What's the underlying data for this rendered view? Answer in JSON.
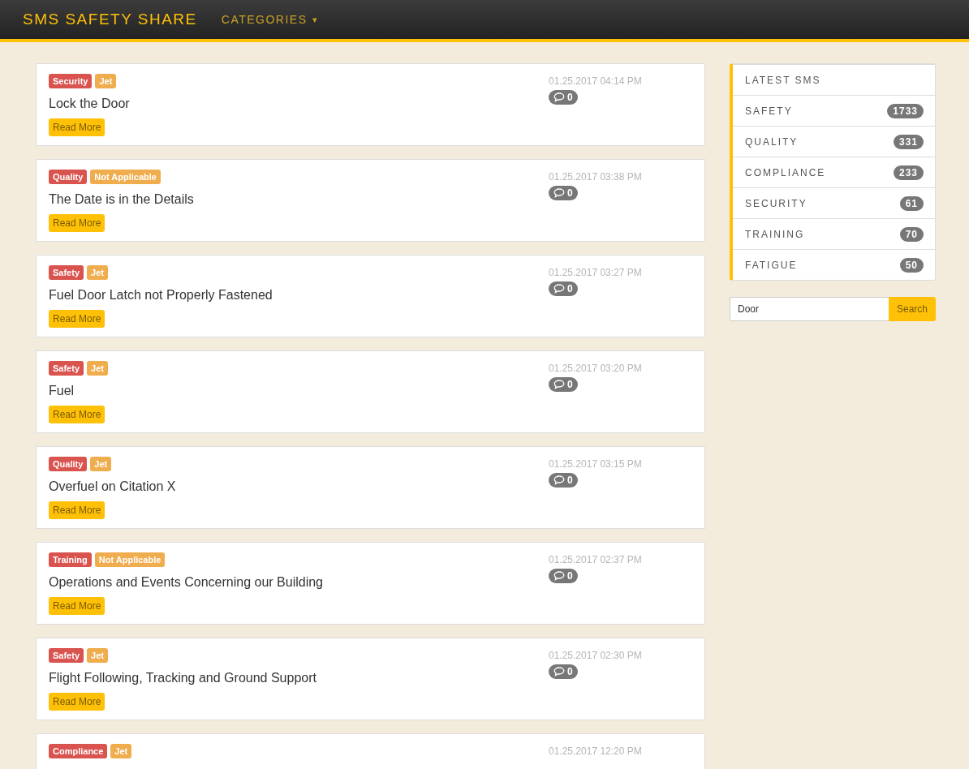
{
  "navbar": {
    "brand": "SMS SAFETY SHARE",
    "menu": {
      "label": "CATEGORIES",
      "caret": "▾"
    }
  },
  "posts": [
    {
      "tags": [
        {
          "kind": "category",
          "text": "Security"
        },
        {
          "kind": "type",
          "text": "Jet"
        }
      ],
      "title": "Lock the Door",
      "button": "Read More",
      "date": "01.25.2017 04:14 PM",
      "comments": "0"
    },
    {
      "tags": [
        {
          "kind": "category",
          "text": "Quality"
        },
        {
          "kind": "type",
          "text": "Not Applicable"
        }
      ],
      "title": "The Date is in the Details",
      "button": "Read More",
      "date": "01.25.2017 03:38 PM",
      "comments": "0"
    },
    {
      "tags": [
        {
          "kind": "category",
          "text": "Safety"
        },
        {
          "kind": "type",
          "text": "Jet"
        }
      ],
      "title": "Fuel Door Latch not Properly Fastened",
      "button": "Read More",
      "date": "01.25.2017 03:27 PM",
      "comments": "0"
    },
    {
      "tags": [
        {
          "kind": "category",
          "text": "Safety"
        },
        {
          "kind": "type",
          "text": "Jet"
        }
      ],
      "title": "Fuel",
      "button": "Read More",
      "date": "01.25.2017 03:20 PM",
      "comments": "0"
    },
    {
      "tags": [
        {
          "kind": "category",
          "text": "Quality"
        },
        {
          "kind": "type",
          "text": "Jet"
        }
      ],
      "title": "Overfuel on Citation X",
      "button": "Read More",
      "date": "01.25.2017 03:15 PM",
      "comments": "0"
    },
    {
      "tags": [
        {
          "kind": "category",
          "text": "Training"
        },
        {
          "kind": "type",
          "text": "Not Applicable"
        }
      ],
      "title": "Operations and Events Concerning our Building",
      "button": "Read More",
      "date": "01.25.2017 02:37 PM",
      "comments": "0"
    },
    {
      "tags": [
        {
          "kind": "category",
          "text": "Safety"
        },
        {
          "kind": "type",
          "text": "Jet"
        }
      ],
      "title": "Flight Following, Tracking and Ground Support",
      "button": "Read More",
      "date": "01.25.2017 02:30 PM",
      "comments": "0"
    },
    {
      "tags": [
        {
          "kind": "category",
          "text": "Compliance"
        },
        {
          "kind": "type",
          "text": "Jet"
        }
      ],
      "date": "01.25.2017 12:20 PM"
    }
  ],
  "sidebar": {
    "items": [
      {
        "label": "LATEST SMS"
      },
      {
        "label": "SAFETY",
        "count": "1733"
      },
      {
        "label": "QUALITY",
        "count": "331"
      },
      {
        "label": "COMPLIANCE",
        "count": "233"
      },
      {
        "label": "SECURITY",
        "count": "61"
      },
      {
        "label": "TRAINING",
        "count": "70"
      },
      {
        "label": "FATIGUE",
        "count": "50"
      }
    ]
  },
  "search": {
    "value": "Door",
    "button": "Search"
  }
}
